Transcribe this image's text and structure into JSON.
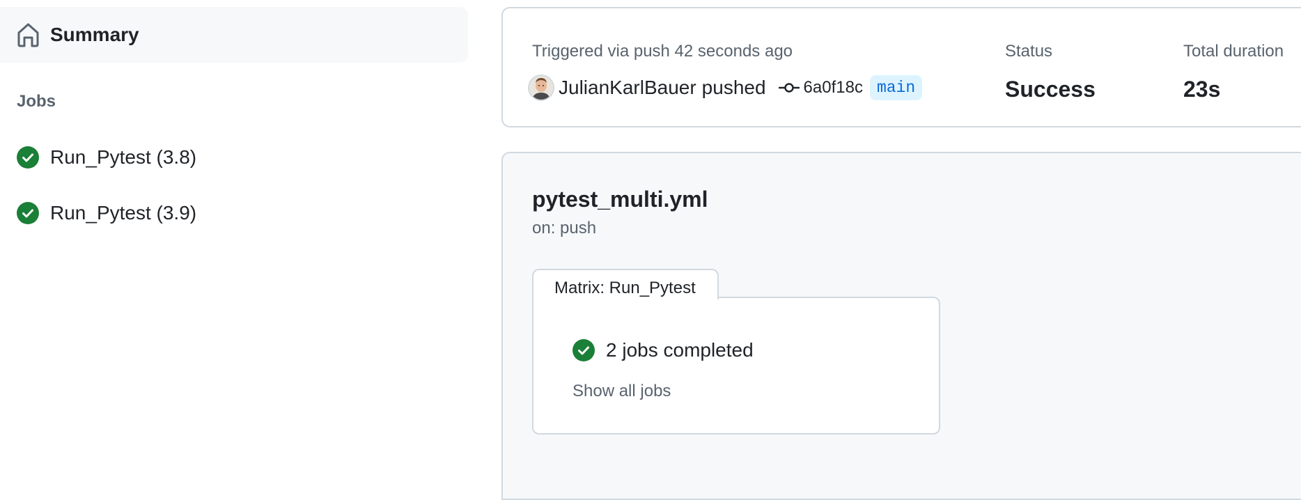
{
  "sidebar": {
    "summary_label": "Summary",
    "jobs_heading": "Jobs",
    "jobs": [
      {
        "label": "Run_Pytest (3.8)",
        "status": "success"
      },
      {
        "label": "Run_Pytest (3.9)",
        "status": "success"
      }
    ]
  },
  "run": {
    "trigger_text": "Triggered via push 42 seconds ago",
    "actor": "JulianKarlBauer",
    "action": "pushed",
    "commit_sha": "6a0f18c",
    "branch": "main",
    "status_label": "Status",
    "status_value": "Success",
    "duration_label": "Total duration",
    "duration_value": "23s"
  },
  "workflow": {
    "file_name": "pytest_multi.yml",
    "trigger": "on: push",
    "matrix": {
      "tab_label": "Matrix: Run_Pytest",
      "completed_text": "2 jobs completed",
      "show_all_label": "Show all jobs"
    }
  },
  "icons": {
    "summary": "home-icon",
    "job_status": "check-circle-fill-icon",
    "commit": "git-commit-icon"
  },
  "colors": {
    "success": "#1a7f37",
    "link_blue": "#0969da",
    "branch_bg": "#ddf4ff",
    "muted_text": "#59636e",
    "border": "#d1d9e0",
    "subtle_bg": "#f6f8fa"
  }
}
